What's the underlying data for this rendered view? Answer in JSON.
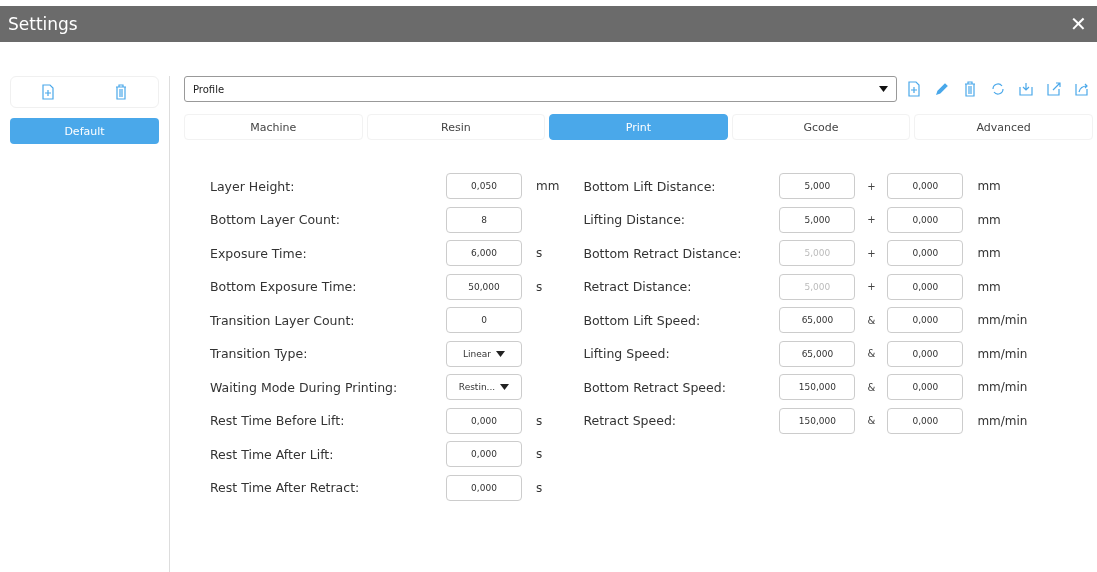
{
  "window": {
    "title": "Settings",
    "close": "✕"
  },
  "sidebar": {
    "profiles": [
      {
        "label": "Default",
        "selected": true
      }
    ]
  },
  "profile_select": {
    "value": "Profile"
  },
  "tabs": [
    {
      "label": "Machine",
      "selected": false
    },
    {
      "label": "Resin",
      "selected": false
    },
    {
      "label": "Print",
      "selected": true
    },
    {
      "label": "Gcode",
      "selected": false
    },
    {
      "label": "Advanced",
      "selected": false
    }
  ],
  "left_fields": [
    {
      "kind": "input",
      "label": "Layer Height:",
      "value": "0,050",
      "unit": "mm"
    },
    {
      "kind": "input",
      "label": "Bottom Layer Count:",
      "value": "8"
    },
    {
      "kind": "input",
      "label": "Exposure Time:",
      "value": "6,000",
      "unit": "s"
    },
    {
      "kind": "input",
      "label": "Bottom Exposure Time:",
      "value": "50,000",
      "unit": "s"
    },
    {
      "kind": "input",
      "label": "Transition Layer Count:",
      "value": "0"
    },
    {
      "kind": "select",
      "label": "Transition Type:",
      "value": "Linear"
    },
    {
      "kind": "select",
      "label": "Waiting Mode During Printing:",
      "value": "Restin..."
    },
    {
      "kind": "input",
      "label": "Rest Time Before Lift:",
      "value": "0,000",
      "unit": "s"
    },
    {
      "kind": "input",
      "label": "Rest Time After Lift:",
      "value": "0,000",
      "unit": "s"
    },
    {
      "kind": "input",
      "label": "Rest Time After Retract:",
      "value": "0,000",
      "unit": "s"
    }
  ],
  "right_fields": [
    {
      "label": "Bottom Lift Distance:",
      "value": "5,000",
      "disabled": false,
      "joiner": "+",
      "value_2": "0,000",
      "unit": "mm"
    },
    {
      "label": "Lifting Distance:",
      "value": "5,000",
      "disabled": false,
      "joiner": "+",
      "value_2": "0,000",
      "unit": "mm"
    },
    {
      "label": "Bottom Retract Distance:",
      "value": "5,000",
      "disabled": true,
      "joiner": "+",
      "value_2": "0,000",
      "unit": "mm"
    },
    {
      "label": "Retract Distance:",
      "value": "5,000",
      "disabled": true,
      "joiner": "+",
      "value_2": "0,000",
      "unit": "mm"
    },
    {
      "label": "Bottom Lift Speed:",
      "value": "65,000",
      "disabled": false,
      "joiner": "&",
      "value_2": "0,000",
      "unit": "mm/min"
    },
    {
      "label": "Lifting Speed:",
      "value": "65,000",
      "disabled": false,
      "joiner": "&",
      "value_2": "0,000",
      "unit": "mm/min"
    },
    {
      "label": "Bottom Retract Speed:",
      "value": "150,000",
      "disabled": false,
      "joiner": "&",
      "value_2": "0,000",
      "unit": "mm/min"
    },
    {
      "label": "Retract Speed:",
      "value": "150,000",
      "disabled": false,
      "joiner": "&",
      "value_2": "0,000",
      "unit": "mm/min"
    }
  ]
}
